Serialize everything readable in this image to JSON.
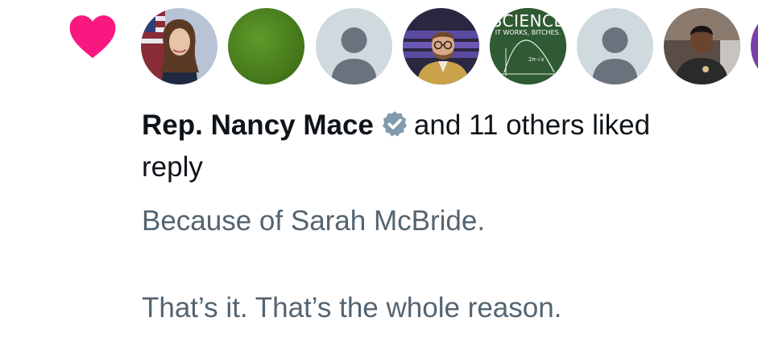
{
  "like_notification": {
    "heart_color": "#f91880",
    "liker_name": "Rep. Nancy Mace",
    "liked_suffix": "and 11 others liked",
    "liked_object": "reply",
    "verified_badge_color": "#829aab",
    "avatars": [
      {
        "name": "avatar-nancy-mace",
        "type": "photo"
      },
      {
        "name": "avatar-green",
        "type": "solid",
        "color": "#4a7f1e"
      },
      {
        "name": "avatar-default-1",
        "type": "default"
      },
      {
        "name": "avatar-man-glasses",
        "type": "photo"
      },
      {
        "name": "avatar-science",
        "type": "text",
        "title": "SCIENCE",
        "subtitle": "IT WORKS, BITCHES."
      },
      {
        "name": "avatar-default-2",
        "type": "default"
      },
      {
        "name": "avatar-man-dark",
        "type": "photo"
      },
      {
        "name": "avatar-purple-partial",
        "type": "solid",
        "color": "#7b3fa8"
      }
    ]
  },
  "reply": {
    "line1": "Because of Sarah McBride.",
    "line2": "That’s it. That’s the whole reason."
  }
}
